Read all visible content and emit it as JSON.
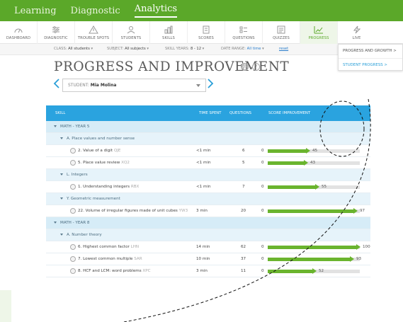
{
  "topnav": {
    "items": [
      {
        "label": "Learning",
        "active": false
      },
      {
        "label": "Diagnostic",
        "active": false
      },
      {
        "label": "Analytics",
        "active": true
      }
    ]
  },
  "tabs": [
    {
      "label": "DASHBOARD",
      "icon": "dashboard-icon",
      "active": false
    },
    {
      "label": "DIAGNOSTIC",
      "icon": "diagnostic-icon",
      "active": false
    },
    {
      "label": "TROUBLE SPOTS",
      "icon": "trouble-spots-icon",
      "active": false
    },
    {
      "label": "STUDENTS",
      "icon": "students-icon",
      "active": false
    },
    {
      "label": "SKILLS",
      "icon": "skills-icon",
      "active": false
    },
    {
      "label": "SCORES",
      "icon": "scores-icon",
      "active": false
    },
    {
      "label": "QUESTIONS",
      "icon": "questions-icon",
      "active": false
    },
    {
      "label": "QUIZZES",
      "icon": "quizzes-icon",
      "active": false
    },
    {
      "label": "PROGRESS",
      "icon": "progress-icon",
      "active": true
    },
    {
      "label": "LIVE",
      "icon": "live-icon",
      "active": false
    }
  ],
  "filters": {
    "class_label": "CLASS:",
    "class_value": "All students",
    "subject_label": "SUBJECT:",
    "subject_value": "All subjects",
    "years_label": "SKILL YEARS:",
    "years_value": "8 - 12",
    "range_label": "DATE RANGE:",
    "range_value": "All time",
    "reset": "reset"
  },
  "dropdown": {
    "options": [
      "PROGRESS AND GROWTH >",
      "STUDENT PROGRESS >"
    ]
  },
  "page": {
    "title": "PROGRESS AND IMPROVEMENT",
    "print_icon": "print-icon",
    "help_icon": "help-icon"
  },
  "student": {
    "label": "STUDENT:",
    "value": "Mia Molina"
  },
  "table": {
    "headers": {
      "skill": "SKILL",
      "time": "TIME SPENT",
      "questions": "QUESTIONS",
      "score": "SCORE IMPROVEMENT"
    },
    "rows": [
      {
        "type": "subject",
        "text": "MATH - YEAR 5"
      },
      {
        "type": "domain",
        "text": "A. Place values and number sense"
      },
      {
        "type": "skill",
        "text": "2. Value of a digit",
        "code": "QJE",
        "time": "<1 min",
        "questions": "6",
        "start": "0",
        "score": 45,
        "label": "45"
      },
      {
        "type": "skill",
        "text": "5. Place value review",
        "code": "XQ2",
        "time": "<1 min",
        "questions": "5",
        "start": "0",
        "score": 43,
        "label": "43"
      },
      {
        "type": "domain",
        "text": "L. Integers"
      },
      {
        "type": "skill",
        "text": "1. Understanding integers",
        "code": "RBX",
        "time": "<1 min",
        "questions": "7",
        "start": "0",
        "score": 55,
        "label": "55"
      },
      {
        "type": "domain",
        "text": "Y. Geometric measurement"
      },
      {
        "type": "skill",
        "text": "22. Volume of irregular figures made of unit cubes",
        "code": "YW3",
        "time": "3 min",
        "questions": "20",
        "start": "0",
        "score": 97,
        "label": "97"
      },
      {
        "type": "subject",
        "text": "MATH - YEAR 8"
      },
      {
        "type": "domain",
        "text": "A. Number theory"
      },
      {
        "type": "skill",
        "text": "6. Highest common factor",
        "code": "LHN",
        "time": "14 min",
        "questions": "62",
        "start": "0",
        "score": 100,
        "label": "100"
      },
      {
        "type": "skill",
        "text": "7. Lowest common multiple",
        "code": "SAR",
        "time": "10 min",
        "questions": "37",
        "start": "0",
        "score": 93,
        "label": "93"
      },
      {
        "type": "skill",
        "text": "8. HCF and LCM: word problems",
        "code": "XPC",
        "time": "3 min",
        "questions": "11",
        "start": "0",
        "score": 52,
        "label": "52"
      }
    ]
  },
  "colors": {
    "brand_green": "#5ba829",
    "header_blue": "#2aa3df",
    "bar_green": "#6ab42e"
  }
}
